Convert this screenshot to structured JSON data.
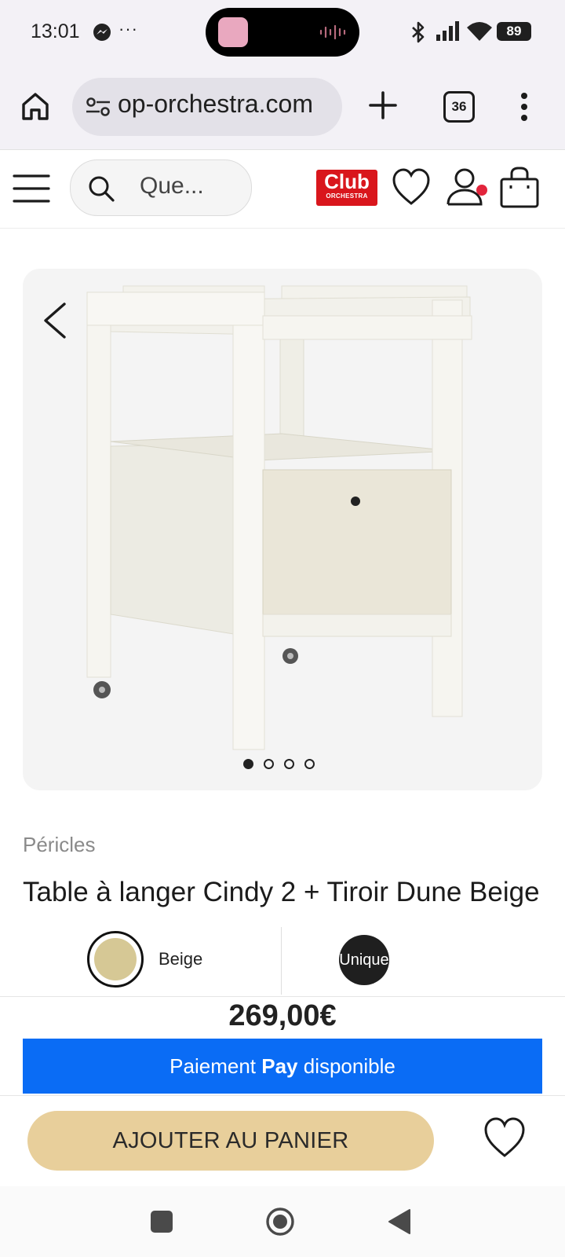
{
  "status_bar": {
    "time": "13:01",
    "more": "···",
    "battery": "89",
    "icons": [
      "messenger-icon",
      "bluetooth-icon",
      "signal-icon",
      "wifi-icon",
      "battery-icon"
    ]
  },
  "browser": {
    "url": "op-orchestra.com",
    "tab_count": "36",
    "icons": [
      "home-icon",
      "site-settings-icon",
      "new-tab-icon",
      "tab-switcher-icon",
      "menu-icon"
    ]
  },
  "header": {
    "search_placeholder": "Que...",
    "club_label": "Club",
    "club_sub": "ORCHESTRA",
    "icons": [
      "hamburger-icon",
      "search-icon",
      "heart-icon",
      "user-icon",
      "bag-icon"
    ],
    "club_color": "#d9161c"
  },
  "gallery": {
    "total_slides": 4,
    "active_slide": 1,
    "background": "#f4f4f4"
  },
  "product": {
    "brand": "Péricles",
    "title": "Table à langer Cindy 2 + Tiroir Dune Beige",
    "color_label": "Beige",
    "color_hex": "#d6c895",
    "size_label": "Unique",
    "price": "269,00€"
  },
  "payment": {
    "prefix": "Paiement",
    "apple_glyph": "",
    "pay": "Pay",
    "suffix": "disponible",
    "color": "#0a6cf5"
  },
  "actions": {
    "add_to_cart": "AJOUTER AU PANIER",
    "button_color": "#e8cf9b"
  }
}
